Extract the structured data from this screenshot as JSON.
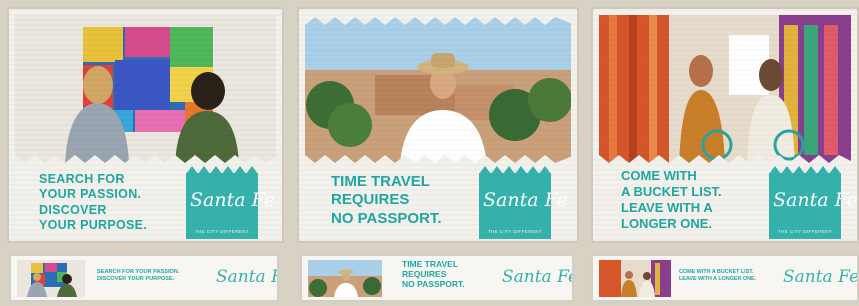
{
  "ads": [
    {
      "headline_lines": [
        "Search for",
        "your passion.",
        "Discover",
        "your purpose."
      ],
      "logo_script": "Santa Fe",
      "logo_tagline": "THE CITY DIFFERENT"
    },
    {
      "headline_lines": [
        "Time travel",
        "requires",
        "no passport."
      ],
      "logo_script": "Santa Fe",
      "logo_tagline": "THE CITY DIFFERENT"
    },
    {
      "headline_lines": [
        "Come with",
        "a bucket list.",
        "Leave with a",
        "longer one."
      ],
      "logo_script": "Santa Fe",
      "logo_tagline": "THE CITY DIFFERENT"
    }
  ],
  "banners": [
    {
      "text_lines": [
        "Search for your passion.",
        "Discover your purpose."
      ],
      "logo_script": "Santa Fe"
    },
    {
      "text_lines": [
        "Time travel",
        "requires",
        "no passport."
      ],
      "logo_script": "Santa Fe"
    },
    {
      "text_lines": [
        "Come with a bucket list.",
        "Leave with a longer one."
      ],
      "logo_script": "Santa Fe"
    }
  ],
  "colors": {
    "brand_teal": "#21a7a3",
    "logo_teal": "#36b2ad",
    "background": "#d8d2c4"
  }
}
